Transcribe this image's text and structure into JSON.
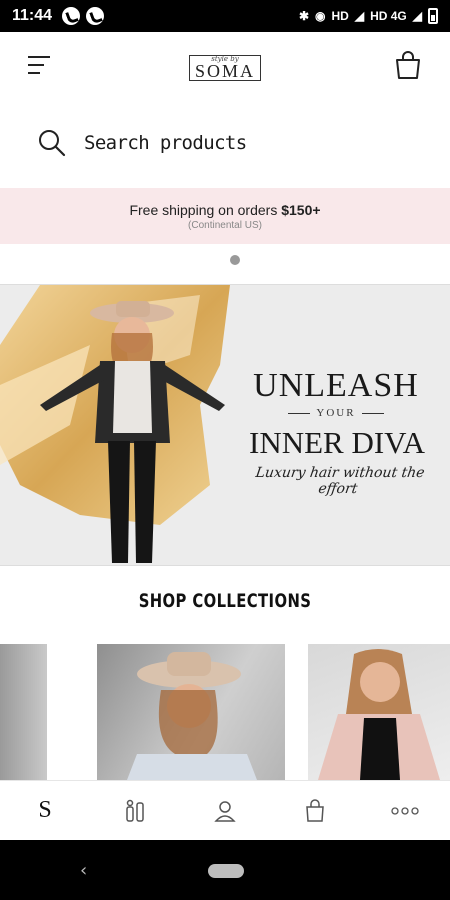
{
  "status_bar": {
    "time": "11:44",
    "network": "HD",
    "network2": "HD 4G"
  },
  "header": {
    "logo_tagline": "style by",
    "logo_brand": "SOMA",
    "menu_icon": "hamburger-menu-icon",
    "cart_icon": "shopping-bag-icon"
  },
  "search": {
    "placeholder": "Search products",
    "icon": "search-icon"
  },
  "promo": {
    "text": "Free shipping on orders",
    "amount": "$150+",
    "note": "(Continental US)"
  },
  "banner": {
    "line1": "UNLEASH",
    "line2": "YOUR",
    "line3": "INNER DIVA",
    "tagline": "Luxury hair without the effort"
  },
  "collections": {
    "title": "SHOP COLLECTIONS"
  },
  "bottom_nav": {
    "home_label": "S",
    "items": [
      "home-logo",
      "products-icon",
      "account-icon",
      "cart-icon",
      "more-icon"
    ]
  },
  "colors": {
    "promo_bg": "#f9e8ea",
    "accent_gold": "#d4a24a"
  }
}
